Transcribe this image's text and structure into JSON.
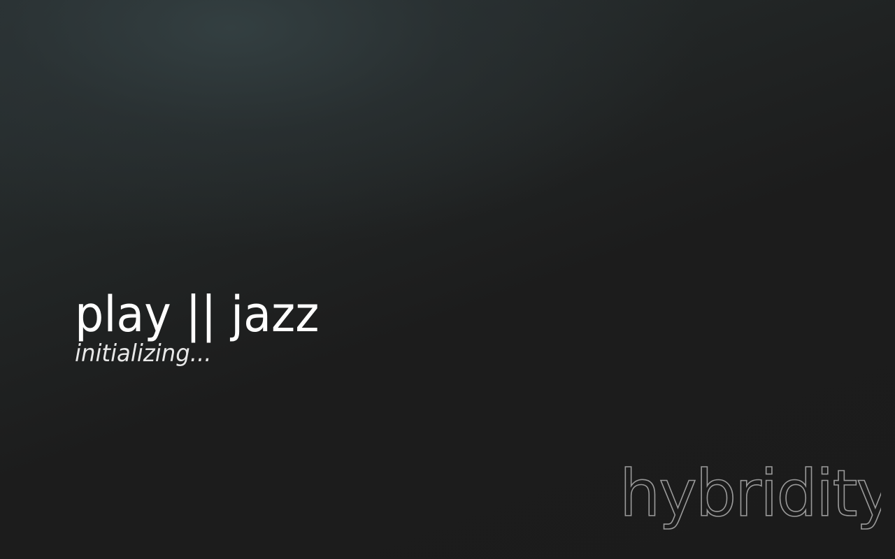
{
  "app": {
    "title": "play || jazz",
    "status": "initializing..."
  },
  "brand": {
    "logo_text": "hybridity",
    "logo_color": "#9a9a9a"
  },
  "colors": {
    "background": "#1c1c1c",
    "text": "#ffffff"
  }
}
